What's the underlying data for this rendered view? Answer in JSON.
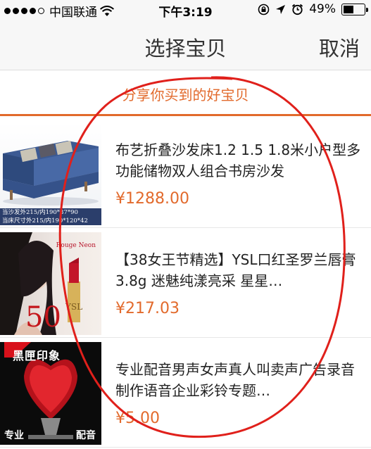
{
  "status_bar": {
    "carrier": "中国联通",
    "time": "下午3:19",
    "battery_text": "49%",
    "battery_level": 0.49
  },
  "nav": {
    "title": "选择宝贝",
    "cancel_label": "取消"
  },
  "share_header": "分享你买到的好宝贝",
  "products": [
    {
      "title": "布艺折叠沙发床1.2 1.5 1.8米小户型多功能储物双人组合书房沙发",
      "price": "¥1288.00",
      "image_caption_1": "当沙发外215/内190*87*90",
      "image_caption_2": "当床尺寸外215/内190*120*42"
    },
    {
      "title": "【38女王节精选】YSL口红圣罗兰唇膏3.8g 迷魅纯漾亮采 星星…",
      "price": "¥217.03",
      "image_brand": "Rouge Neon",
      "image_number": "50"
    },
    {
      "title": "专业配音男声女声真人叫卖声广告录音制作语音企业彩铃专题…",
      "price": "¥5.00",
      "image_title": "黑匣印象",
      "image_left": "专业",
      "image_right": "配音"
    }
  ],
  "colors": {
    "accent": "#e26a2c",
    "annotation": "#e0201b"
  }
}
